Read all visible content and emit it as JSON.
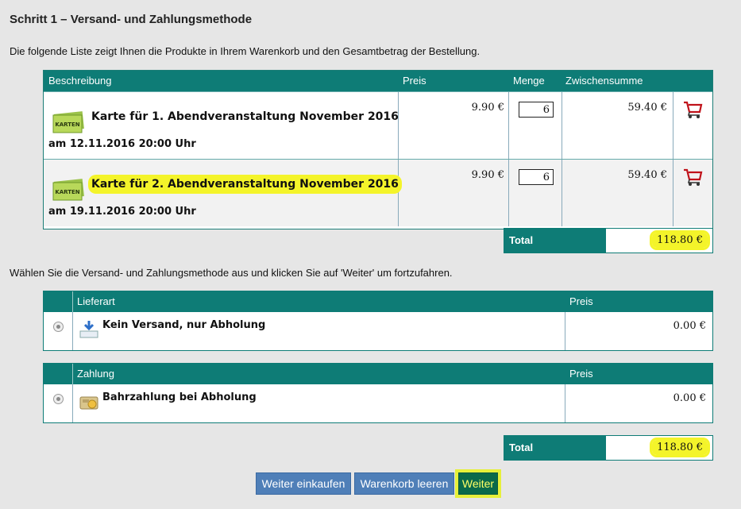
{
  "step_title": "Schritt 1 – Versand- und Zahlungsmethode",
  "intro_text": "Die folgende Liste zeigt Ihnen die Produkte in Ihrem Warenkorb und den Gesamtbetrag der Bestellung.",
  "cart": {
    "headers": [
      "Beschreibung",
      "Preis",
      "Menge",
      "Zwischensumme"
    ],
    "items": [
      {
        "ticket_label": "KARTEN",
        "name": "Karte für 1. Abendveranstaltung November 2016",
        "date": "am 12.11.2016 20:00 Uhr",
        "price": "9.90 €",
        "qty": "6",
        "subtotal": "59.40 €"
      },
      {
        "ticket_label": "KARTEN",
        "name": "Karte für 2. Abendveranstaltung November 2016",
        "date": "am 19.11.2016 20:00 Uhr",
        "price": "9.90 €",
        "qty": "6",
        "subtotal": "59.40 €"
      }
    ],
    "total_label": "Total",
    "total_value": "118.80 €"
  },
  "choose_text": "Wählen Sie die Versand- und Zahlungsmethode aus und klicken Sie auf 'Weiter' um fortzufahren.",
  "shipping": {
    "header": "Lieferart",
    "price_header": "Preis",
    "option": "Kein Versand, nur Abholung",
    "price": "0.00 €",
    "icon": "download-icon"
  },
  "payment": {
    "header": "Zahlung",
    "price_header": "Preis",
    "option": "Bahrzahlung bei Abholung",
    "price": "0.00 €",
    "icon": "cash-icon"
  },
  "grand_total": {
    "label": "Total",
    "value": "118.80 €"
  },
  "buttons": {
    "continue_shopping": "Weiter einkaufen",
    "empty_cart": "Warenkorb leeren",
    "next": "Weiter"
  },
  "colors": {
    "header_teal": "#0e7c76",
    "highlight": "#f4f42a",
    "button_blue": "#4f7fb8"
  }
}
